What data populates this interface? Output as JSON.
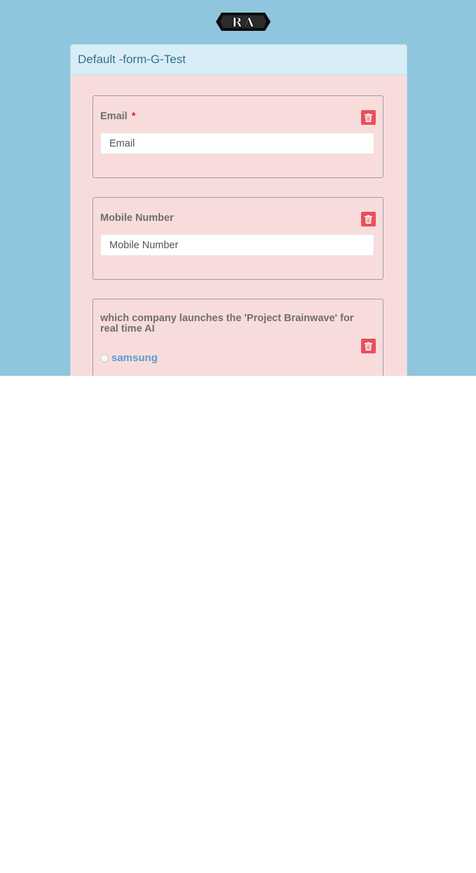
{
  "logo": {
    "text": "RA"
  },
  "form": {
    "title": "Default -form-G-Test",
    "fields": [
      {
        "label": "Email",
        "required_mark": "*",
        "placeholder": "Email"
      },
      {
        "label": "Mobile Number",
        "placeholder": "Mobile Number"
      }
    ],
    "question": {
      "label": "which company launches the 'Project Brainwave' for real time AI",
      "options": [
        {
          "label": "samsung"
        }
      ]
    }
  },
  "icons": {
    "delete": "trash-icon",
    "delete_color": "#e9505a"
  },
  "colors": {
    "page_bg": "#8fc5dd",
    "panel_bg": "#f8dcdc",
    "heading_bg": "#d9edf7",
    "option_text": "#5b9bd5"
  }
}
